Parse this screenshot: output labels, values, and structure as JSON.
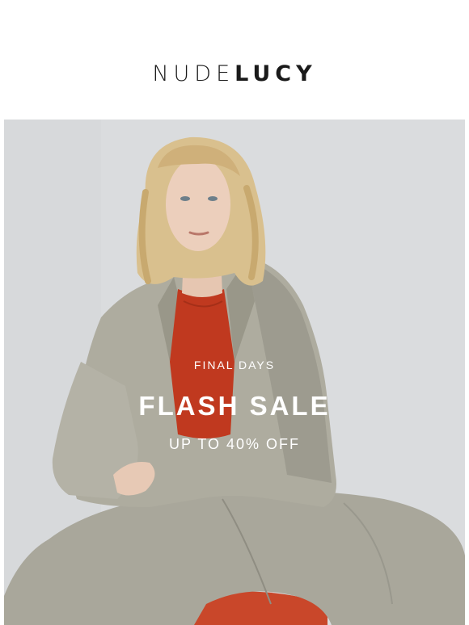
{
  "brand": {
    "logo_light": "NUDE",
    "logo_bold": "LUCY"
  },
  "hero": {
    "eyebrow": "FINAL DAYS",
    "headline": "FLASH SALE",
    "subhead": "UP TO 40% OFF",
    "image_alt": "Model seated wearing a grey oversized suit and red top"
  },
  "colors": {
    "logo": "#1a1a1a",
    "overlay_text": "#ffffff",
    "background": "#dcdee0",
    "suit": "#a8a69a",
    "top": "#c23a22"
  }
}
